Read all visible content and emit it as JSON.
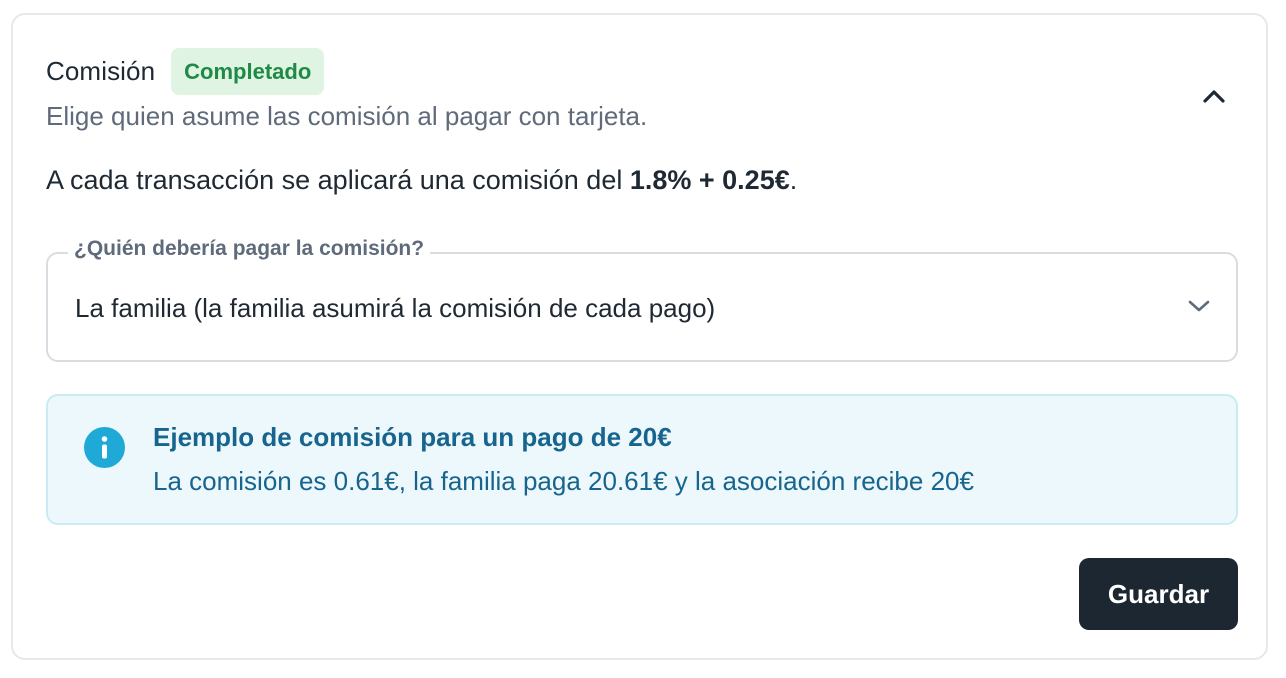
{
  "section": {
    "title": "Comisión",
    "status_badge": "Completado",
    "subtitle": "Elige quien asume las comisión al pagar con tarjeta.",
    "collapse_icon": "chevron-up-icon"
  },
  "rate": {
    "prefix": "A cada transacción se aplicará una comisión del ",
    "value": "1.8% + 0.25€",
    "suffix": "."
  },
  "payer_select": {
    "label": "¿Quién debería pagar la comisión?",
    "selected_value": "La familia (la familia asumirá la comisión de cada pago)",
    "icon": "chevron-down-icon"
  },
  "info": {
    "icon": "info-icon",
    "title": "Ejemplo de comisión para un pago de 20€",
    "text": "La comisión es 0.61€, la familia paga 20.61€ y la asociación recibe 20€"
  },
  "actions": {
    "save_label": "Guardar"
  },
  "colors": {
    "badge_bg": "#dff4e3",
    "badge_text": "#1f8a45",
    "info_bg": "#ecf8fb",
    "info_border": "#c9ebf3",
    "info_icon": "#1fa9d6",
    "info_text": "#17658f",
    "button_bg": "#1d2731"
  }
}
